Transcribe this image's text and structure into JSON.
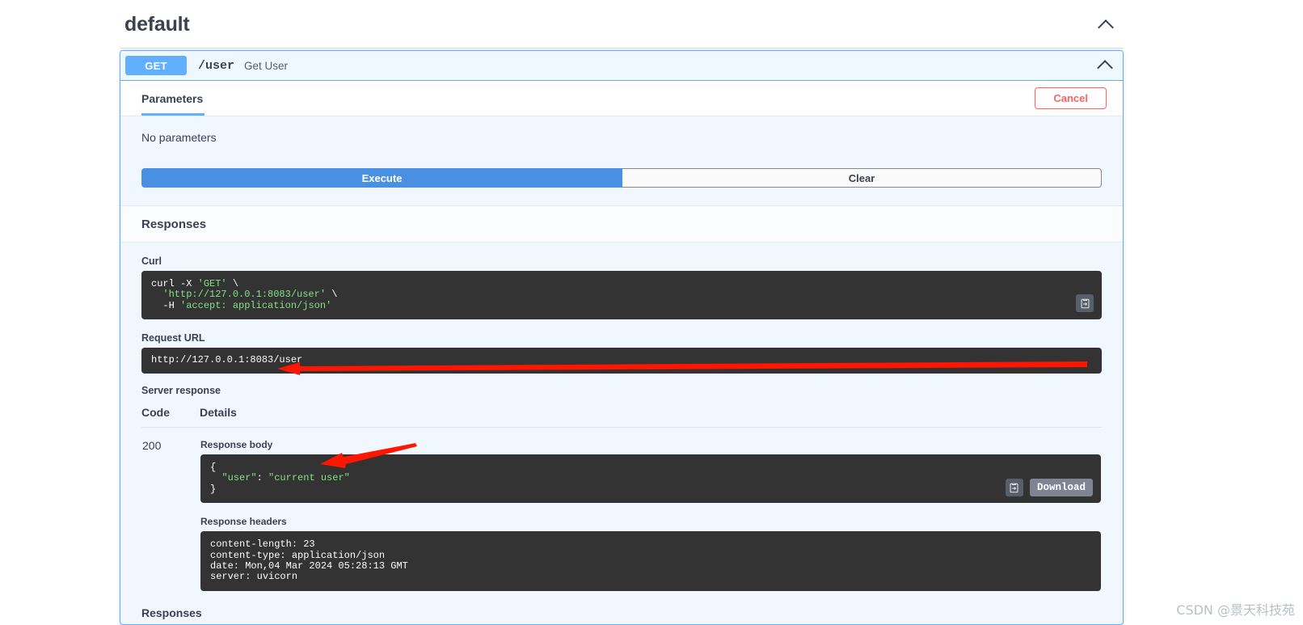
{
  "tag": {
    "title": "default",
    "collapse_icon": "chevron-up-icon"
  },
  "operation": {
    "method": "GET",
    "path": "/user",
    "summary": "Get User",
    "collapse_icon": "chevron-up-icon"
  },
  "params_section": {
    "tab_label": "Parameters",
    "cancel_label": "Cancel",
    "no_parameters_text": "No parameters",
    "execute_label": "Execute",
    "clear_label": "Clear"
  },
  "responses_header": "Responses",
  "live_response": {
    "curl_label": "Curl",
    "curl_lines": [
      {
        "cmd": "curl",
        "rest": " -X ",
        "quoted": "'GET'",
        "tail": " \\"
      },
      {
        "indent": "  ",
        "quoted": "'http://127.0.0.1:8083/user'",
        "tail": " \\"
      },
      {
        "indent": "  ",
        "flag": "-H ",
        "quoted": "'accept: application/json'",
        "tail": ""
      }
    ],
    "curl_text": "curl -X 'GET' \\\n  'http://127.0.0.1:8083/user' \\\n  -H 'accept: application/json'",
    "request_url_label": "Request URL",
    "request_url": "http://127.0.0.1:8083/user",
    "server_response_label": "Server response",
    "copy_icon": "copy-to-clipboard-icon"
  },
  "response_table": {
    "columns": [
      "Code",
      "Details"
    ],
    "rows": [
      {
        "code": "200",
        "response_body_label": "Response body",
        "response_body": "{\n  \"user\": \"current user\"\n}",
        "response_body_key": "\"user\"",
        "response_body_value": "\"current user\"",
        "download_label": "Download",
        "copy_icon": "copy-to-clipboard-icon",
        "response_headers_label": "Response headers",
        "response_headers": [
          {
            "name": "content-length:",
            "value": " 23"
          },
          {
            "name": "content-type:",
            "value": " application/json"
          },
          {
            "name": "date:",
            "value": " Mon,04 Mar 2024 05:28:13 GMT"
          },
          {
            "name": "server:",
            "value": " uvicorn"
          }
        ]
      }
    ]
  },
  "bottom_responses_label": "Responses",
  "annotations": {
    "arrow_request_url": "red-arrow-pointing-to-request-url",
    "arrow_response_body": "red-arrow-pointing-to-response-body"
  },
  "watermark": "CSDN @景天科技苑",
  "colors": {
    "get_method": "#61affe",
    "execute": "#4990e2",
    "cancel": "#ff6060",
    "code_bg": "#333333",
    "code_string": "#84e184",
    "panel_bg": "#f0f7ff",
    "annotation": "#ff0000"
  }
}
